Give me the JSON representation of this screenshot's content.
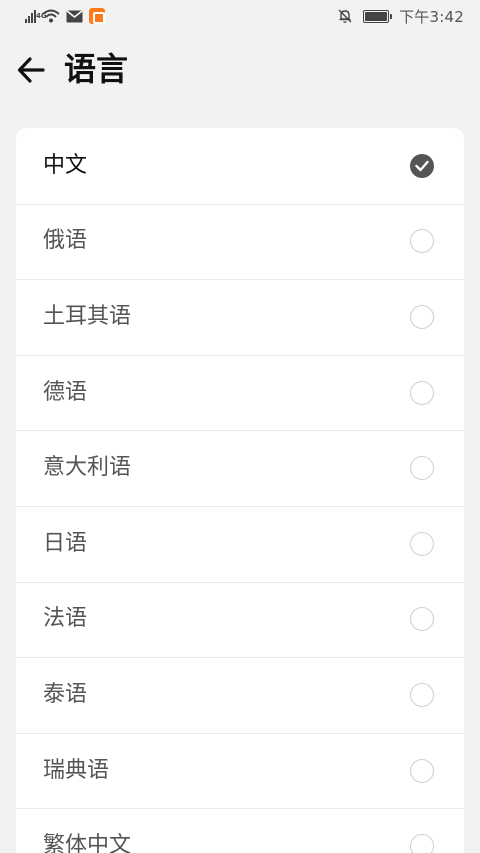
{
  "status_bar": {
    "network_type": "4G",
    "time": "下午3:42",
    "icons": [
      "signal-icon",
      "wifi-icon",
      "mail-icon",
      "app-notification-icon",
      "mute-bell-icon",
      "battery-icon"
    ]
  },
  "header": {
    "title": "语言",
    "back_icon": "arrow-left-icon"
  },
  "languages": [
    {
      "label": "中文",
      "selected": true
    },
    {
      "label": "俄语",
      "selected": false
    },
    {
      "label": "土耳其语",
      "selected": false
    },
    {
      "label": "德语",
      "selected": false
    },
    {
      "label": "意大利语",
      "selected": false
    },
    {
      "label": "日语",
      "selected": false
    },
    {
      "label": "法语",
      "selected": false
    },
    {
      "label": "泰语",
      "selected": false
    },
    {
      "label": "瑞典语",
      "selected": false
    },
    {
      "label": "繁体中文",
      "selected": false
    }
  ],
  "colors": {
    "background": "#f2f2f2",
    "card": "#ffffff",
    "checked_radio": "#555555",
    "unchecked_radio_border": "#cfcfcf"
  }
}
